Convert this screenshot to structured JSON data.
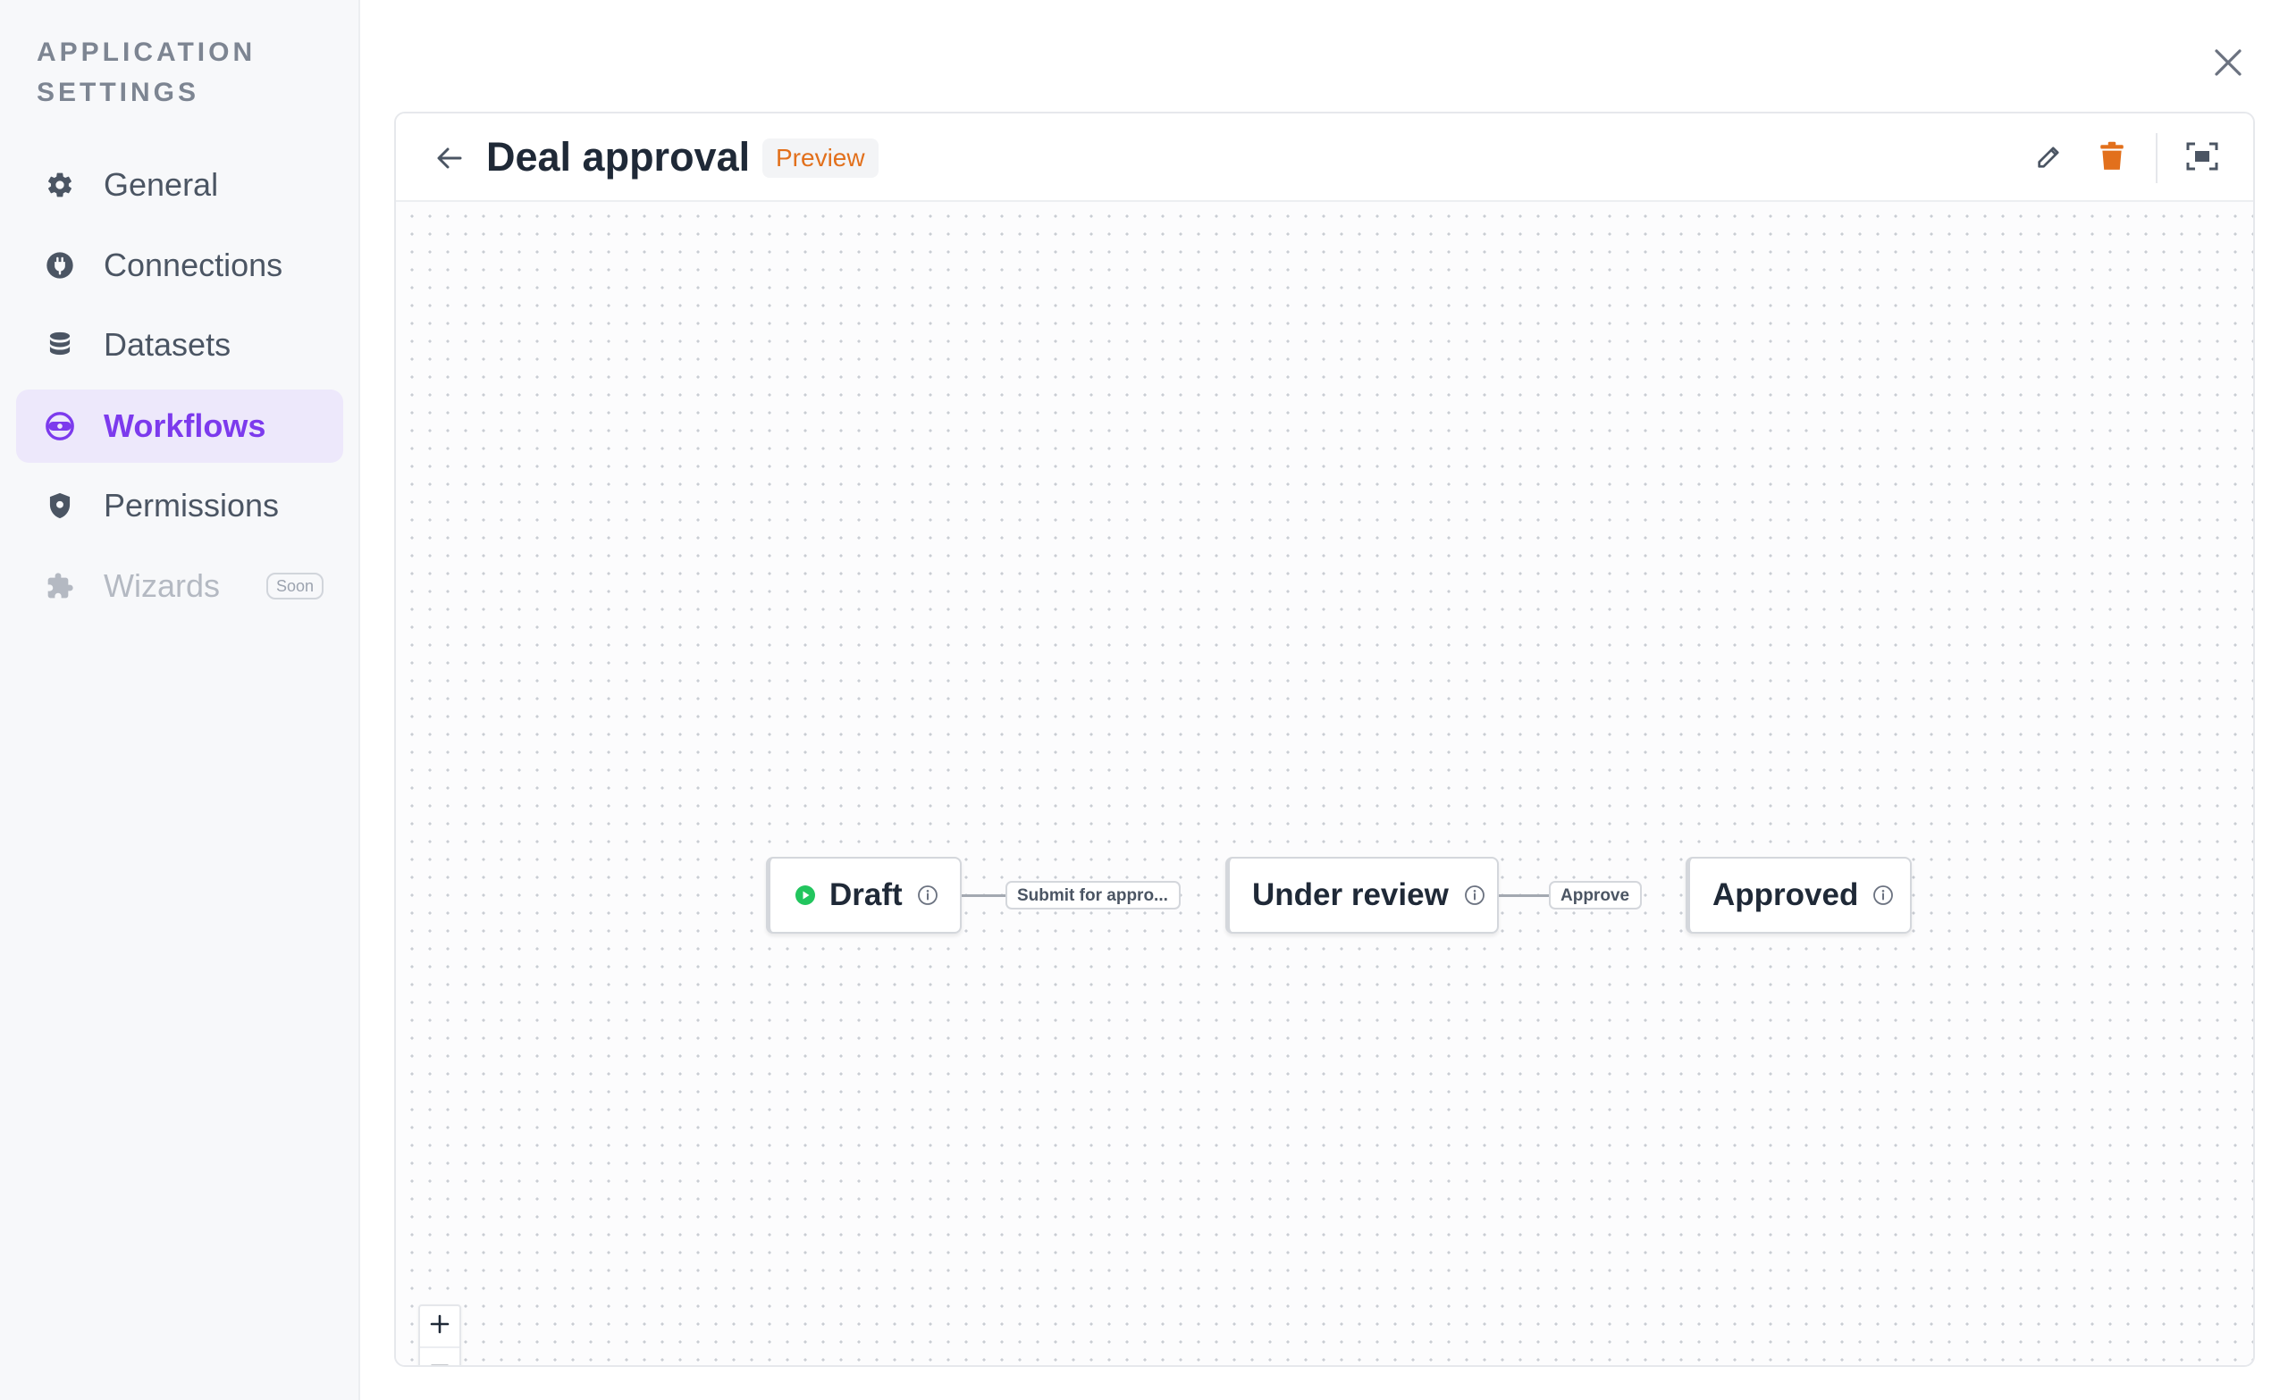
{
  "sidebar": {
    "title": "APPLICATION SETTINGS",
    "items": [
      {
        "label": "General",
        "icon": "gear-icon"
      },
      {
        "label": "Connections",
        "icon": "plug-icon"
      },
      {
        "label": "Datasets",
        "icon": "database-icon"
      },
      {
        "label": "Workflows",
        "icon": "workflow-icon",
        "active": true
      },
      {
        "label": "Permissions",
        "icon": "shield-icon"
      },
      {
        "label": "Wizards",
        "icon": "puzzle-icon",
        "disabled": true,
        "badge": "Soon"
      }
    ]
  },
  "workflow": {
    "title": "Deal approval",
    "badge": "Preview",
    "actions": [
      "edit-icon",
      "trash-icon",
      "fit-screen-icon"
    ]
  },
  "graph": {
    "nodes": [
      {
        "label": "Draft",
        "is_start": true
      },
      {
        "label": "Under review"
      },
      {
        "label": "Approved"
      }
    ],
    "edges": [
      {
        "label": "Submit for appro..."
      },
      {
        "label": "Approve"
      }
    ]
  },
  "zoom_controls": [
    "zoom-in-icon",
    "zoom-out-icon",
    "fit-view-icon"
  ],
  "colors": {
    "accent": "#7c3aed",
    "active_bg": "#ede8fb",
    "preview_text": "#e2701c",
    "delete": "#e2701c",
    "start_dot": "#22c55e"
  }
}
